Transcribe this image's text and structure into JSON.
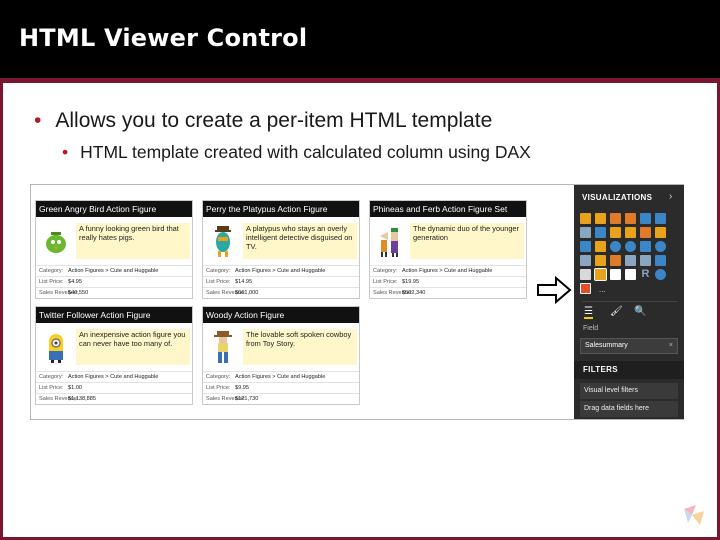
{
  "slide": {
    "title": "HTML Viewer Control",
    "bullets": [
      "Allows you to create a per-item HTML template",
      "HTML template created with calculated column using DAX"
    ]
  },
  "colors": {
    "accent": "#7a1730",
    "title_bg": "#000000",
    "card_desc_bg": "#fff6c9",
    "pane_bg": "#2b2b2b"
  },
  "cards": [
    {
      "name": "Green Angry Bird Action Figure",
      "description": "A funny looking green bird that really hates pigs.",
      "category_label": "Category:",
      "category": "Action Figures > Cute and Huggable",
      "price_label": "List Price:",
      "price": "$4.95",
      "sales_label": "Sales Revenue:",
      "sales": "$40,550",
      "icon": "green-bird-figure-icon"
    },
    {
      "name": "Perry the Platypus Action Figure",
      "description": "A platypus who stays an overly intelligent detective disguised on TV.",
      "category_label": "Category:",
      "category": "Action Figures > Cute and Huggable",
      "price_label": "List Price:",
      "price": "$14.95",
      "sales_label": "Sales Revenue:",
      "sales": "$661,000",
      "icon": "platypus-figure-icon"
    },
    {
      "name": "Phineas and Ferb Action Figure Set",
      "description": "The dynamic duo of the younger generation",
      "category_label": "Category:",
      "category": "Action Figures > Cute and Huggable",
      "price_label": "List Price:",
      "price": "$19.95",
      "sales_label": "Sales Revenue:",
      "sales": "$502,340",
      "icon": "phineas-ferb-figure-icon"
    },
    {
      "name": "Twitter Follower Action Figure",
      "description": "An inexpensive action figure you can never have too many of.",
      "category_label": "Category:",
      "category": "Action Figures > Cute and Huggable",
      "price_label": "List Price:",
      "price": "$1.00",
      "sales_label": "Sales Revenue:",
      "sales": "$1,138,885",
      "icon": "minion-figure-icon"
    },
    {
      "name": "Woody Action Figure",
      "description": "The lovable soft spoken cowboy from Toy Story.",
      "category_label": "Category:",
      "category": "Action Figures > Cute and Huggable",
      "price_label": "List Price:",
      "price": "$9.95",
      "sales_label": "Sales Revenue:",
      "sales": "$121,730",
      "icon": "cowboy-figure-icon"
    }
  ],
  "viz_pane": {
    "title": "VISUALIZATIONS",
    "chevron": "›",
    "ellipsis": "...",
    "field_label": "Field",
    "field_value": "Salesummary",
    "field_clear": "×",
    "filters_title": "FILTERS",
    "filter_items": [
      "Visual level filters",
      "Drag data fields here"
    ],
    "selected_visual": "html-viewer-icon"
  }
}
